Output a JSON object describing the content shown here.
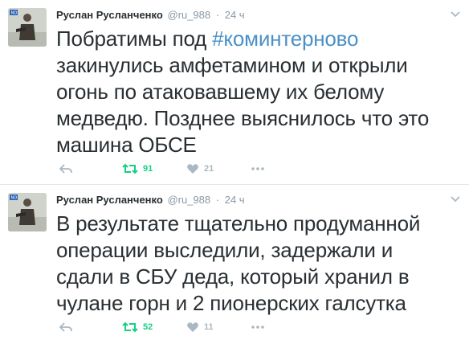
{
  "tweets": [
    {
      "fullname": "Руслан Русланченко",
      "username": "@ru_988",
      "dot": "·",
      "time": "24 ч",
      "text_before": "Побратимы под ",
      "hashtag": "#коминтерново",
      "text_after": "\nзакинулись амфетамином и открыли\nогонь по атаковавшему их белому\nмедведю. Позднее выяснилось что это\nмашина ОБСЕ",
      "retweets": "91",
      "likes": "21",
      "icons": [
        "avatar",
        "chevron-down-icon",
        "reply-icon",
        "retweet-icon",
        "heart-icon",
        "more-icon"
      ]
    },
    {
      "fullname": "Руслан Русланченко",
      "username": "@ru_988",
      "dot": "·",
      "time": "24 ч",
      "text": "В  результате тщательно продуманной\nоперации выследили, задержали и\nсдали в СБУ деда, который хранил в\nчулане горн и 2 пионерских галсутка",
      "retweets": "52",
      "likes": "11",
      "icons": [
        "avatar",
        "chevron-down-icon",
        "reply-icon",
        "retweet-icon",
        "heart-icon",
        "more-icon"
      ]
    }
  ],
  "colors": {
    "text": "#292f33",
    "muted": "#8899a6",
    "hashtag": "#4a90c8",
    "retweet": "#19cf86",
    "like": "#aab8c2",
    "divider": "#e1e8ed"
  }
}
